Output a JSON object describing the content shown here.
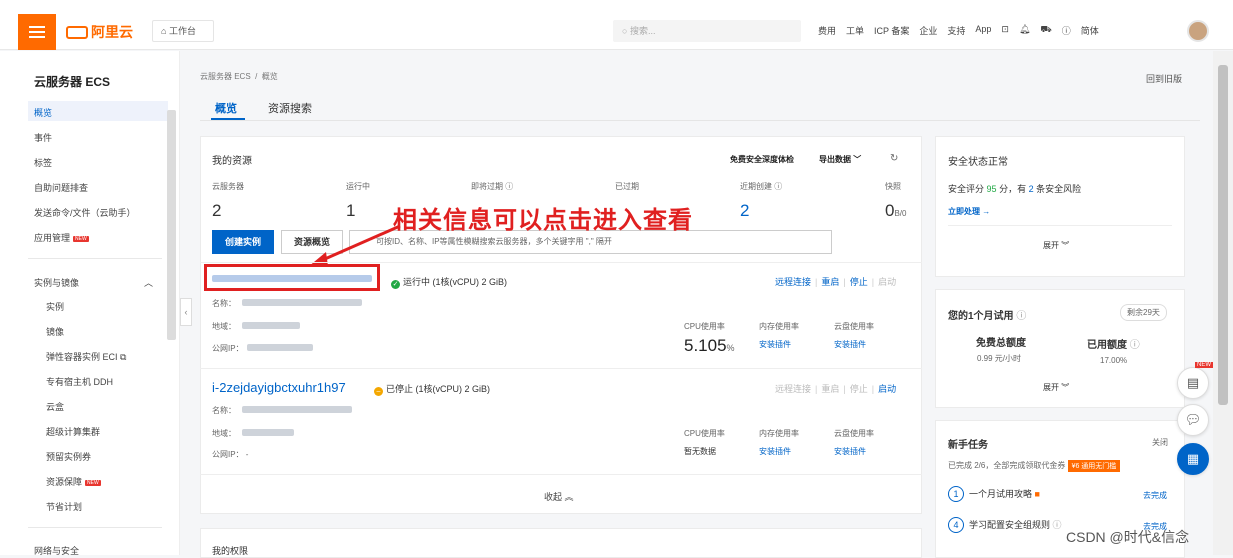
{
  "topbar": {
    "brand": "阿里云",
    "workspace": "工作台",
    "search_placeholder": "搜索...",
    "nav": [
      "费用",
      "工单",
      "ICP 备案",
      "企业",
      "支持",
      "App",
      "简体"
    ]
  },
  "sidebar": {
    "title": "云服务器 ECS",
    "items": [
      "概览",
      "事件",
      "标签",
      "自助问题排查",
      "发送命令/文件（云助手）",
      "应用管理"
    ],
    "group": "实例与镜像",
    "sub_items": [
      "实例",
      "镜像",
      "弹性容器实例 ECI",
      "专有宿主机 DDH",
      "云盒",
      "超级计算集群",
      "预留实例券",
      "资源保障",
      "节省计划"
    ],
    "bottom_group": "网络与安全",
    "new_badge": "NEW"
  },
  "breadcrumb": [
    "云服务器 ECS",
    "概览"
  ],
  "back_old": "回到旧版",
  "tabs": [
    "概览",
    "资源搜索"
  ],
  "resources": {
    "title": "我的资源",
    "deep_check": "免费安全深度体检",
    "export": "导出数据",
    "stats": [
      {
        "label": "云服务器",
        "value": "2"
      },
      {
        "label": "运行中",
        "value": "1"
      },
      {
        "label": "即将过期",
        "value": ""
      },
      {
        "label": "已过期",
        "value": ""
      },
      {
        "label": "近期创建",
        "value": "2"
      },
      {
        "label": "快照",
        "value": "0",
        "suffix": "B/0"
      }
    ],
    "create_btn": "创建实例",
    "overview_btn": "资源概览",
    "search_placeholder": "可按ID、名称、IP等属性模糊搜索云服务器，多个关键字用 \",\" 隔开"
  },
  "overlay_text": "相关信息可以点击进入查看",
  "instances": [
    {
      "status": "运行中",
      "spec": "(1核(vCPU) 2 GiB)",
      "name_label": "名称：",
      "region_label": "地域：",
      "ip_label": "公网IP：",
      "ip_value": "",
      "ops": [
        "远程连接",
        "重启",
        "停止",
        "启动"
      ],
      "cpu_label": "CPU使用率",
      "cpu_value": "5.105",
      "cpu_unit": "%",
      "mem_label": "内存使用率",
      "mem_value": "安装插件",
      "disk_label": "云盘使用率",
      "disk_value": "安装插件"
    },
    {
      "id": "i-2zejdayigbctxuhr1h97",
      "status": "已停止",
      "spec": "(1核(vCPU) 2 GiB)",
      "name_label": "名称：",
      "region_label": "地域：",
      "ip_label": "公网IP：",
      "ip_value": "-",
      "ops": [
        "远程连接",
        "重启",
        "停止",
        "启动"
      ],
      "cpu_label": "CPU使用率",
      "cpu_value": "暂无数据",
      "mem_label": "内存使用率",
      "mem_value": "安装插件",
      "disk_label": "云盘使用率",
      "disk_value": "安装插件"
    }
  ],
  "fold": "收起",
  "next_section": "我的权限",
  "security": {
    "title": "安全状态正常",
    "score_text_pre": "安全评分",
    "score": "95",
    "score_text_mid": "分，有",
    "risks": "2",
    "score_text_post": "条安全风险",
    "action": "立即处理 →",
    "expand": "展开"
  },
  "trial": {
    "title": "您的1个月试用",
    "remain": "剩余29天",
    "free_label": "免费总额度",
    "free_value": "0.99 元/小时",
    "used_label": "已用额度",
    "used_value": "17.00%",
    "expand": "展开"
  },
  "tasks": {
    "title": "新手任务",
    "close": "关闭",
    "progress": "已完成 2/6，全部完成领取代金券",
    "coupon": "¥6 通用无门槛",
    "items": [
      {
        "num": "1",
        "label": "一个月试用攻略",
        "action": "去完成"
      },
      {
        "num": "4",
        "label": "学习配置安全组规则",
        "action": "去完成"
      }
    ]
  },
  "watermark": "CSDN @时代&信念"
}
